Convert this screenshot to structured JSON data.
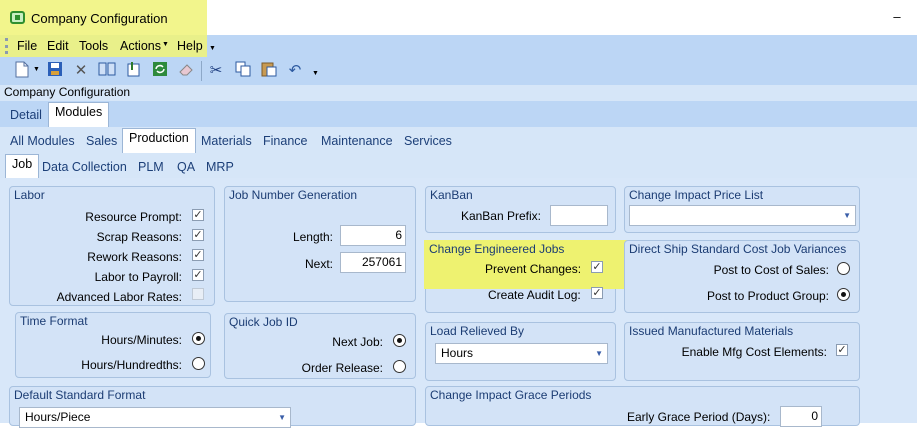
{
  "window": {
    "title": "Company Configuration",
    "minimize": "–"
  },
  "menu": {
    "items": [
      "File",
      "Edit",
      "Tools",
      "Actions",
      "Help"
    ]
  },
  "toolbar": {
    "icons": [
      "new-icon",
      "save-icon",
      "delete-icon",
      "book-icon",
      "attach-icon",
      "refresh-icon",
      "eraser-icon",
      "cut-icon",
      "copy-icon",
      "paste-icon",
      "undo-icon"
    ]
  },
  "header": {
    "title": "Company Configuration"
  },
  "tabs": {
    "top": [
      "Detail",
      "Modules"
    ],
    "modules": [
      "All Modules",
      "Sales",
      "Production",
      "Materials",
      "Finance",
      "Maintenance",
      "Services"
    ],
    "production": [
      "Job",
      "Data Collection",
      "PLM",
      "QA",
      "MRP"
    ]
  },
  "labor": {
    "title": "Labor",
    "resource_prompt": "Resource Prompt:",
    "scrap_reasons": "Scrap Reasons:",
    "rework_reasons": "Rework Reasons:",
    "labor_to_payroll": "Labor to Payroll:",
    "advanced_labor_rates": "Advanced Labor Rates:"
  },
  "time_format": {
    "title": "Time Format",
    "hours_minutes": "Hours/Minutes:",
    "hours_hundredths": "Hours/Hundredths:"
  },
  "job_number_generation": {
    "title": "Job Number Generation",
    "length_label": "Length:",
    "length": "6",
    "next_label": "Next:",
    "next": "257061"
  },
  "quick_job_id": {
    "title": "Quick Job ID",
    "next_job": "Next Job:",
    "order_release": "Order Release:"
  },
  "kanban": {
    "title": "KanBan",
    "prefix_label": "KanBan Prefix:",
    "prefix": ""
  },
  "change_engineered_jobs": {
    "title": "Change Engineered Jobs",
    "prevent_changes": "Prevent Changes:",
    "create_audit_log": "Create Audit Log:"
  },
  "load_relieved_by": {
    "title": "Load Relieved By",
    "value": "Hours"
  },
  "change_impact_price_list": {
    "title": "Change Impact Price List",
    "value": ""
  },
  "direct_ship": {
    "title": "Direct Ship Standard Cost Job Variances",
    "post_cost_of_sales": "Post to Cost of Sales:",
    "post_product_group": "Post to Product Group:"
  },
  "issued_materials": {
    "title": "Issued Manufactured Materials",
    "enable_mfg": "Enable Mfg Cost Elements:"
  },
  "default_standard_format": {
    "title": "Default Standard Format",
    "value": "Hours/Piece"
  },
  "grace_periods": {
    "title": "Change Impact Grace Periods",
    "early_label": "Early Grace Period (Days):",
    "early": "0"
  },
  "check_mark": "✓"
}
